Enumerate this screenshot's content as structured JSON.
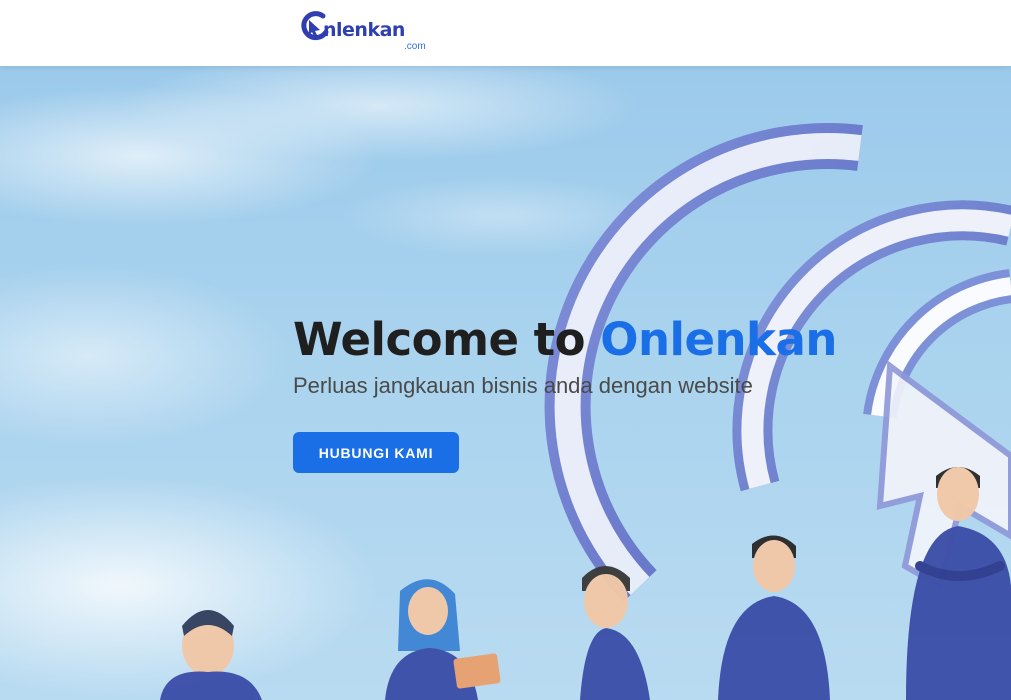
{
  "header": {
    "logo": {
      "icon": "logo-cursor-icon",
      "wordmark": "nlenkan",
      "suffix": ".com"
    }
  },
  "hero": {
    "title_prefix": "Welcome to ",
    "title_brand": "Onlenkan",
    "subtitle": "Perluas jangkauan bisnis anda dengan website",
    "cta_label": "HUBUNGI KAMI",
    "illustration": "people-with-logo-illustration"
  },
  "colors": {
    "brand_blue": "#1a6fe6",
    "logo_blue": "#2f3fb0",
    "title_dark": "#1f1f1f",
    "sky": "#a8d2ee"
  }
}
